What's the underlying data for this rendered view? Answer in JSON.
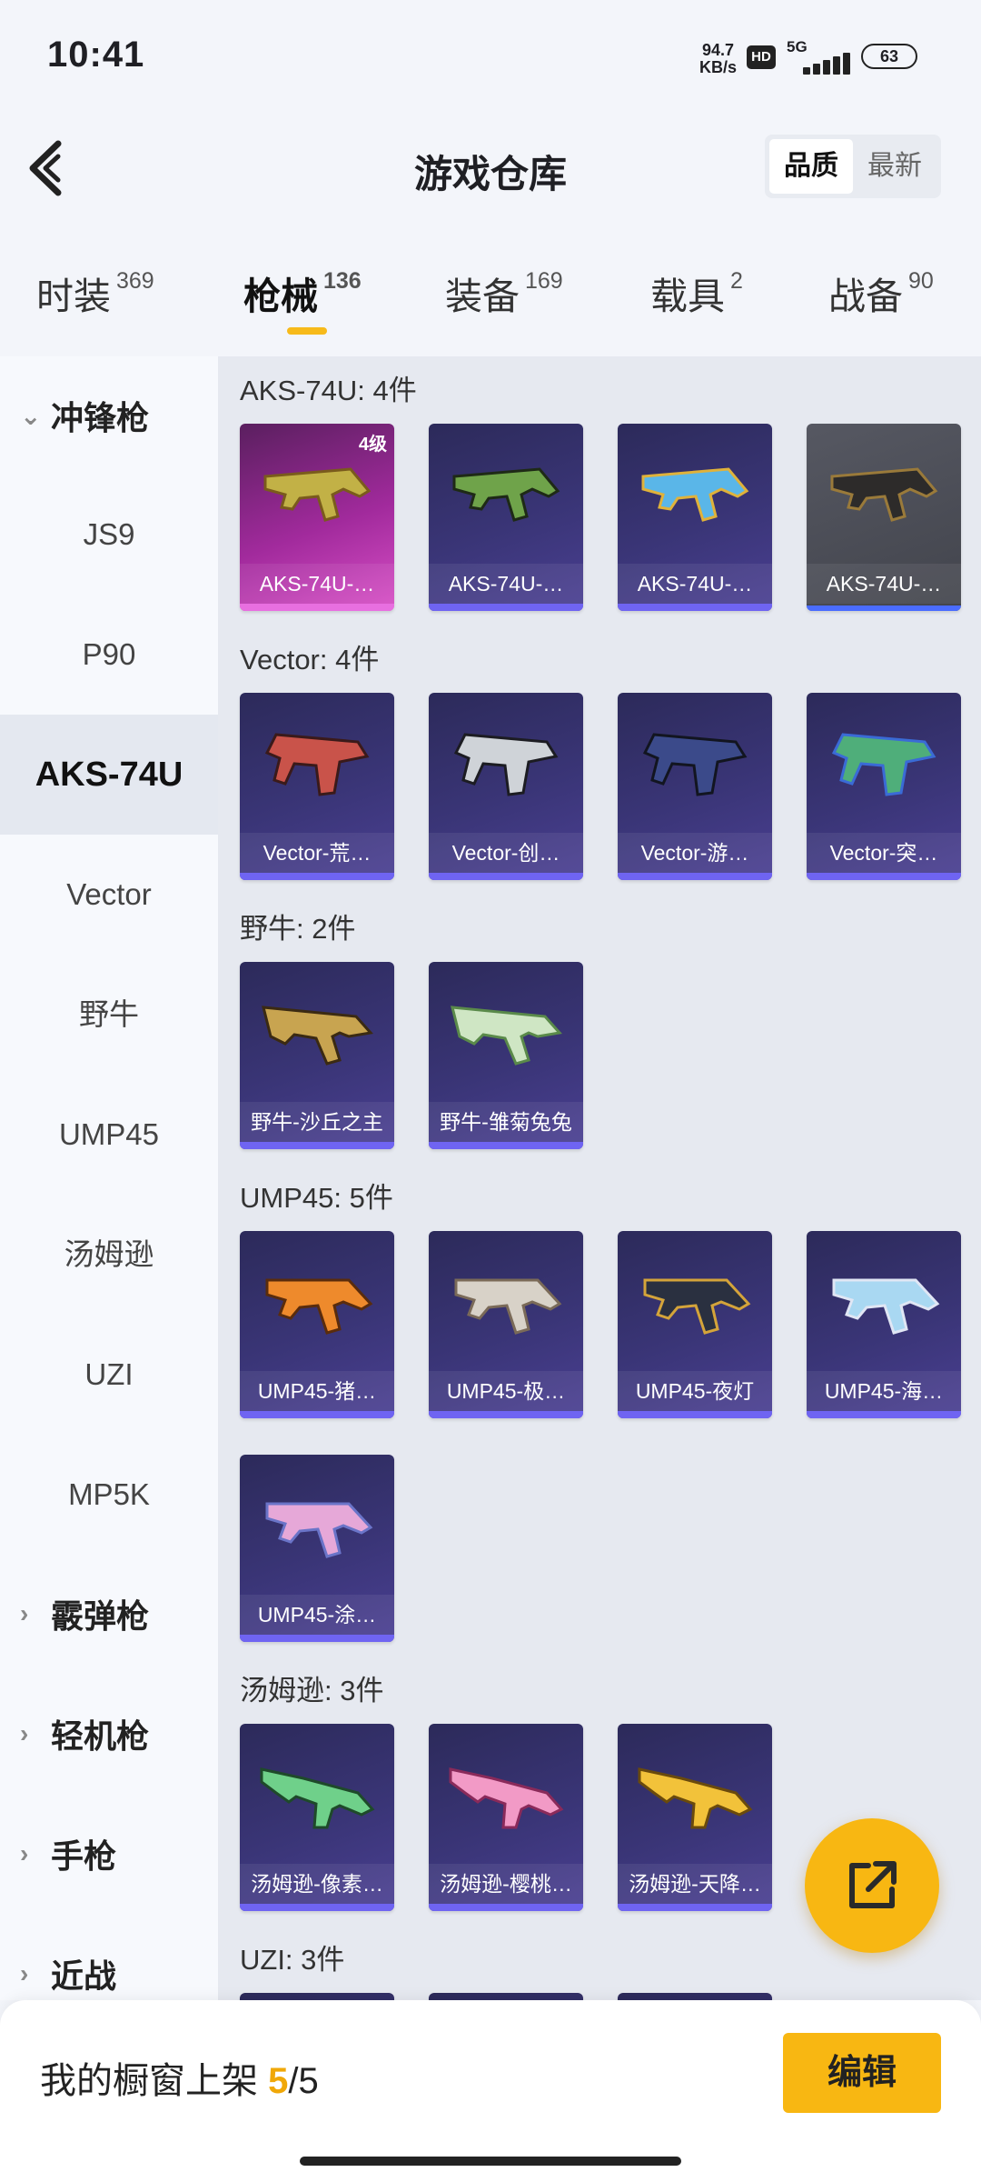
{
  "status": {
    "time": "10:41",
    "net_speed": "94.7",
    "net_unit": "KB/s",
    "hd": "HD",
    "network": "5G",
    "battery": "63"
  },
  "header": {
    "title": "游戏仓库",
    "sort_quality": "品质",
    "sort_newest": "最新"
  },
  "tabs": [
    {
      "label": "时装",
      "count": "369"
    },
    {
      "label": "枪械",
      "count": "136"
    },
    {
      "label": "装备",
      "count": "169"
    },
    {
      "label": "载具",
      "count": "2"
    },
    {
      "label": "战备",
      "count": "90"
    }
  ],
  "sidebar": {
    "cat_smg": "冲锋枪",
    "subs": [
      "JS9",
      "P90",
      "AKS-74U",
      "Vector",
      "野牛",
      "UMP45",
      "汤姆逊",
      "UZI",
      "MP5K"
    ],
    "cat_shotgun": "霰弹枪",
    "cat_lmg": "轻机枪",
    "cat_pistol": "手枪",
    "cat_melee": "近战"
  },
  "groups": {
    "aks": {
      "title": "AKS-74U: 4件",
      "items": [
        "AKS-74U-…",
        "AKS-74U-…",
        "AKS-74U-…",
        "AKS-74U-…"
      ],
      "level": "4级"
    },
    "vector": {
      "title": "Vector: 4件",
      "items": [
        "Vector-荒…",
        "Vector-创…",
        "Vector-游…",
        "Vector-突…"
      ]
    },
    "bizon": {
      "title": "野牛: 2件",
      "items": [
        "野牛-沙丘之主",
        "野牛-雏菊兔兔"
      ]
    },
    "ump": {
      "title": "UMP45: 5件",
      "items": [
        "UMP45-猪…",
        "UMP45-极…",
        "UMP45-夜灯",
        "UMP45-海…",
        "UMP45-涂…"
      ]
    },
    "tommy": {
      "title": "汤姆逊: 3件",
      "items": [
        "汤姆逊-像素…",
        "汤姆逊-樱桃…",
        "汤姆逊-天降…"
      ]
    },
    "uzi": {
      "title": "UZI: 3件"
    }
  },
  "bottom": {
    "shelf_label": "我的橱窗上架",
    "shelf_used": "5",
    "shelf_total": "/5",
    "edit_label": "编辑"
  },
  "colors": {
    "accent": "#f8b712",
    "card_purple": "#3a3577",
    "card_pink": "#a12a9c",
    "card_grey": "#4a4c55"
  }
}
